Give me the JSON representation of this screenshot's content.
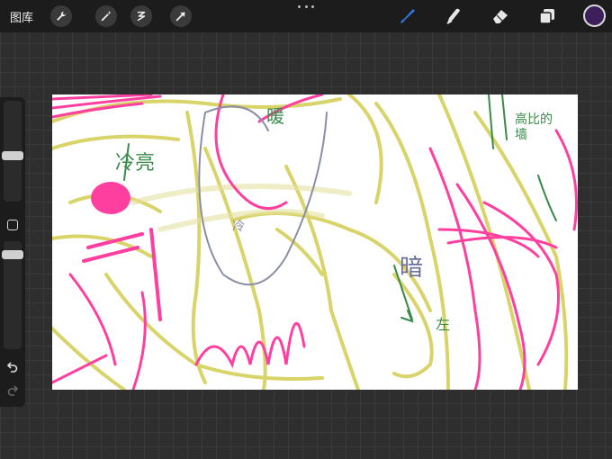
{
  "toolbar": {
    "gallery_label": "图库",
    "left_tools": [
      "wrench-icon",
      "magic-wand-icon",
      "selection-icon",
      "transform-arrow-icon"
    ],
    "right_tools": [
      "brush-icon",
      "smudge-icon",
      "eraser-icon",
      "layers-icon"
    ],
    "active_tool": "brush-icon",
    "current_color": "#3d1f5c",
    "accent_color": "#2f7ae5"
  },
  "sidebar": {
    "undo_icon": "undo-icon",
    "redo_icon": "redo-icon"
  },
  "canvas": {
    "annotations": {
      "cool_light": "冷亮",
      "warm": "暖",
      "dark": "暗",
      "wall_text": "高比的墙",
      "cold": "冷",
      "arrow_note": "左"
    },
    "colors": {
      "pink": "#ff3fa0",
      "yellow": "#d9d46a",
      "green": "#3a8a4a",
      "grey": "#8a8ea6"
    }
  }
}
